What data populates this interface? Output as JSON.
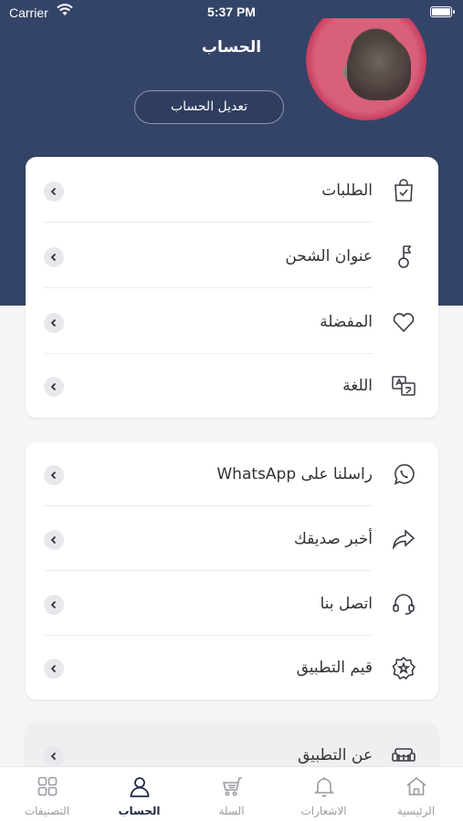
{
  "status_bar": {
    "carrier": "Carrier",
    "time": "5:37 PM"
  },
  "header": {
    "title": "الحساب",
    "edit_button": "تعديل الحساب"
  },
  "colors": {
    "header": "#344468",
    "accent": "#1f2a44"
  },
  "section1": [
    {
      "label": "الطلبات",
      "icon": "shopping-bag-check-icon"
    },
    {
      "label": "عنوان الشحن",
      "icon": "location-flag-icon"
    },
    {
      "label": "المفضلة",
      "icon": "heart-icon"
    },
    {
      "label": "اللغة",
      "icon": "translate-icon"
    }
  ],
  "section2": [
    {
      "label": "راسلنا على WhatsApp",
      "icon": "whatsapp-icon"
    },
    {
      "label": "أخبر صديقك",
      "icon": "share-arrow-icon"
    },
    {
      "label": "اتصل بنا",
      "icon": "headset-icon"
    },
    {
      "label": "قيم التطبيق",
      "icon": "star-badge-icon"
    }
  ],
  "section3": [
    {
      "label": "عن التطبيق",
      "icon": "sofa-icon"
    }
  ],
  "tabs": [
    {
      "label": "الرئيسية",
      "icon": "home-icon"
    },
    {
      "label": "الاشعارات",
      "icon": "bell-icon"
    },
    {
      "label": "السلة",
      "icon": "cart-icon"
    },
    {
      "label": "الحساب",
      "icon": "user-icon",
      "active": true
    },
    {
      "label": "التصنيفات",
      "icon": "grid-icon"
    }
  ]
}
